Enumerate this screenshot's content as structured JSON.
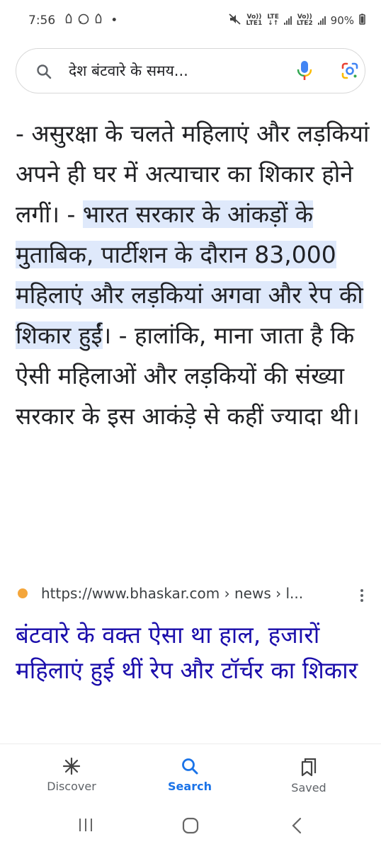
{
  "status_bar": {
    "time": "7:56",
    "dot": "•",
    "sim1_label_top": "Vo))",
    "sim1_label_bottom": "LTE1",
    "lte_label": "LTE",
    "sim2_label_top": "Vo))",
    "sim2_label_bottom": "LTE2",
    "battery": "90%",
    "icons": [
      "notification-icon",
      "whatsapp-icon",
      "notification-icon",
      "mute-icon",
      "signal-icon",
      "battery-icon"
    ]
  },
  "search": {
    "query": "देश बंटवारे के समय...",
    "icons": [
      "search-icon",
      "mic-icon",
      "google-lens-icon"
    ]
  },
  "article": {
    "text_before": "- असुरक्षा के चलते महिलाएं और लड़कियां अपने ही घर में अत्याचार का शिकार होने लगीं। - ",
    "highlighted": "भारत सरकार के आंकड़ों के मुताबिक, पार्टीशन के दौरान 83,000 महिलाएं और लड़कियां अगवा और रेप की शिकार हुईं",
    "text_after": "। - हालांकि, माना जाता है कि ऐसी महिलाओं और लड़कियों की संख्या सरकार के इस आकंड़े से कहीं ज्यादा थी।"
  },
  "result": {
    "url": "https://www.bhaskar.com › news › l...",
    "title": "बंटवारे के वक्त ऐसा था हाल, हजारों महिलाएं हुई थीं रेप और टॉर्चर का शिकार"
  },
  "bottom_nav": {
    "items": [
      {
        "label": "Discover",
        "icon": "asterisk-icon"
      },
      {
        "label": "Search",
        "icon": "search-icon"
      },
      {
        "label": "Saved",
        "icon": "bookmarks-icon"
      }
    ],
    "active_color": "#1a73e8"
  },
  "colors": {
    "highlight": "#dfe9fb",
    "link": "#1a0dab",
    "favicon": "#f4a63b"
  }
}
